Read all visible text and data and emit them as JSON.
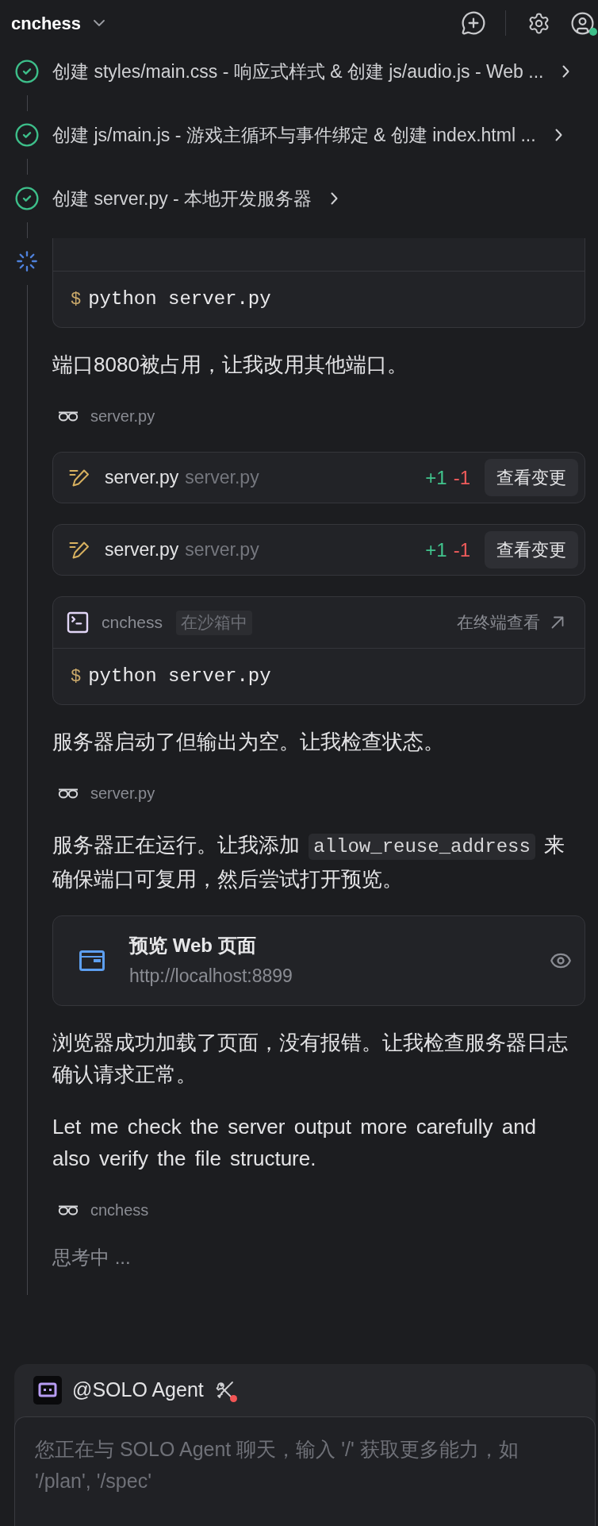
{
  "header": {
    "title": "cnchess",
    "online": true
  },
  "tasks": [
    {
      "label": "创建 styles/main.css - 响应式样式 & 创建 js/audio.js - Web ...",
      "done": true
    },
    {
      "label": "创建 js/main.js - 游戏主循环与事件绑定 & 创建 index.html ...",
      "done": true
    },
    {
      "label": "创建 server.py - 本地开发服务器",
      "done": true
    }
  ],
  "activity": {
    "running": true
  },
  "steps": [
    {
      "kind": "terminal",
      "prompt": "$",
      "command": "python server.py"
    },
    {
      "kind": "text",
      "segments": [
        {
          "kind": "plain",
          "text": "端口8080被占用，让我改用其他端口。"
        }
      ]
    },
    {
      "kind": "read",
      "target": "server.py"
    },
    {
      "kind": "diff",
      "file": "server.py",
      "path": "server.py",
      "added": "+1",
      "removed": "-1",
      "action": "查看变更"
    },
    {
      "kind": "diff",
      "file": "server.py",
      "path": "server.py",
      "added": "+1",
      "removed": "-1",
      "action": "查看变更"
    },
    {
      "kind": "terminal",
      "workspace": "cnchess",
      "badge": "在沙箱中",
      "link": "在终端查看",
      "prompt": "$",
      "command": "python server.py"
    },
    {
      "kind": "text",
      "segments": [
        {
          "kind": "plain",
          "text": "服务器启动了但输出为空。让我检查状态。"
        }
      ]
    },
    {
      "kind": "read",
      "target": "server.py"
    },
    {
      "kind": "text",
      "segments": [
        {
          "kind": "plain",
          "text": "服务器正在运行。让我添加"
        },
        {
          "kind": "code",
          "text": "allow_reuse_address"
        },
        {
          "kind": "plain",
          "text": "来确保端口可复用，然后尝试打开预览。"
        }
      ]
    },
    {
      "kind": "preview",
      "title": "预览 Web 页面",
      "url": "http://localhost:8899"
    },
    {
      "kind": "text",
      "segments": [
        {
          "kind": "plain",
          "text": "浏览器成功加载了页面，没有报错。让我检查服务器日志确认请求正常。"
        }
      ]
    },
    {
      "kind": "text",
      "segments": [
        {
          "kind": "plain",
          "text": "Let me check the server output more carefully and also verify the file structure."
        }
      ]
    },
    {
      "kind": "read",
      "target": "cnchess"
    },
    {
      "kind": "thinking",
      "label": "思考中 ..."
    }
  ],
  "composer": {
    "agent": "@SOLO Agent",
    "tools_alert": true,
    "placeholder": "您正在与 SOLO Agent 聊天，输入 '/' 获取更多能力，如 '/plan', '/spec'"
  }
}
